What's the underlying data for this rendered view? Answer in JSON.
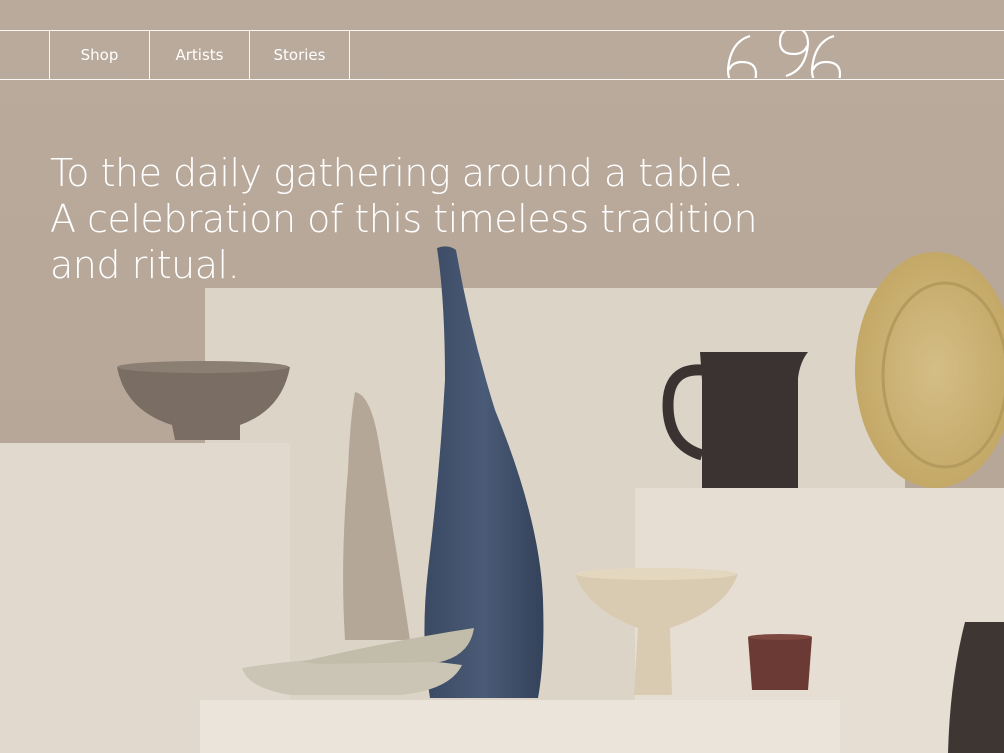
{
  "nav": {
    "items": [
      {
        "label": "Shop"
      },
      {
        "label": "Artists"
      },
      {
        "label": "Stories"
      }
    ]
  },
  "logo": {
    "mark": "6-9-6-logo-icon"
  },
  "hero": {
    "headline": "To the daily gathering around a table. A celebration of this timeless tradition and ritual.",
    "image": "ceramics-still-life-image"
  },
  "colors": {
    "wall": "#b7a899",
    "pedestal": "#e3dbd0",
    "vase_blue": "#44556e",
    "pitcher": "#3a3331",
    "plate_gold": "#cfb57c"
  }
}
